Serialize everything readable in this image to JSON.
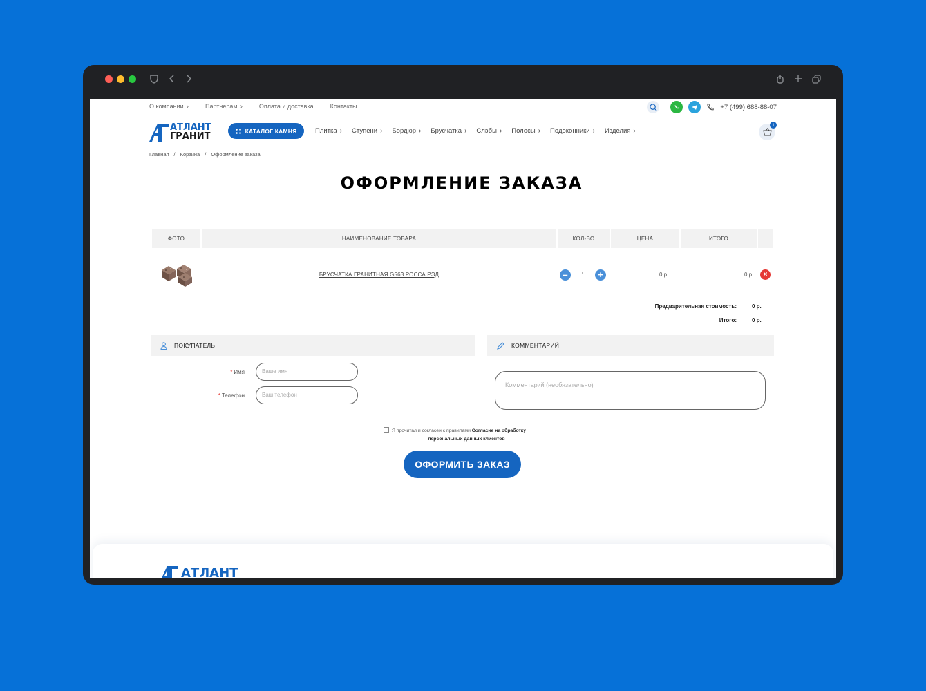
{
  "colors": {
    "brand": "#1565c0",
    "accent": "#4a90d9",
    "danger": "#e53935",
    "background": "#0671d8"
  },
  "topbar": {
    "nav": [
      {
        "label": "О компании",
        "chevron": true
      },
      {
        "label": "Партнерам",
        "chevron": true
      },
      {
        "label": "Оплата и доставка",
        "chevron": false
      },
      {
        "label": "Контакты",
        "chevron": false
      }
    ],
    "phone": "+7 (499) 688-88-07"
  },
  "header": {
    "logo_line1": "АТЛАНТ",
    "logo_line2": "ГРАНИТ",
    "catalog_label": "КАТАЛОГ КАМНЯ",
    "nav": [
      "Плитка",
      "Ступени",
      "Бордюр",
      "Брусчатка",
      "Слэбы",
      "Полосы",
      "Подоконники",
      "Изделия"
    ],
    "cart_count": "1"
  },
  "breadcrumb": [
    "Главная",
    "Корзина",
    "Оформление заказа"
  ],
  "page_title": "ОФОРМЛЕНИЕ ЗАКАЗА",
  "table": {
    "headers": {
      "photo": "ФОТО",
      "name": "НАИМЕНОВАНИЕ ТОВАРА",
      "qty": "КОЛ-ВО",
      "price": "ЦЕНА",
      "total": "ИТОГО"
    },
    "rows": [
      {
        "name": "БРУСЧАТКА ГРАНИТНАЯ G563 РОССА РЭД",
        "qty": "1",
        "price": "0 р.",
        "total": "0 р."
      }
    ]
  },
  "summary": {
    "preliminary_label": "Предварительная стоимость:",
    "preliminary_value": "0 р.",
    "total_label": "Итого:",
    "total_value": "0 р."
  },
  "buyer": {
    "title": "ПОКУПАТЕЛЬ",
    "name_label": "Имя",
    "name_placeholder": "Ваше имя",
    "phone_label": "Телефон",
    "phone_placeholder": "Ваш телефон"
  },
  "comment": {
    "title": "КОММЕНТАРИЙ",
    "placeholder": "Комментарий (необязательно)"
  },
  "agreement": {
    "text": "Я прочитал и согласен с правилами",
    "link_part1": "Согласие на обработку",
    "link_part2": "персональных данных клиентов"
  },
  "submit_label": "ОФОРМИТЬ ЗАКАЗ",
  "footer": {
    "logo_text": "АТЛАНТ"
  }
}
